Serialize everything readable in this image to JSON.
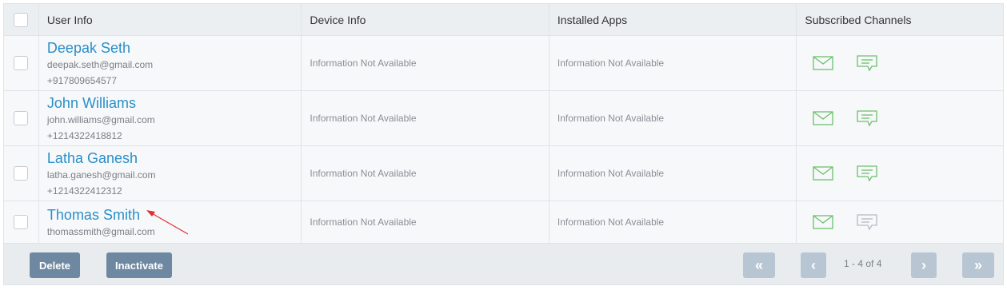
{
  "columns": {
    "user": "User Info",
    "device": "Device Info",
    "apps": "Installed Apps",
    "channels": "Subscribed Channels"
  },
  "rows": [
    {
      "name": "Deepak Seth",
      "email": "deepak.seth@gmail.com",
      "phone": "+917809654577",
      "device": "Information Not Available",
      "apps": "Information Not Available",
      "email_channel": true,
      "sms_channel": true
    },
    {
      "name": "John Williams",
      "email": "john.williams@gmail.com",
      "phone": "+1214322418812",
      "device": "Information Not Available",
      "apps": "Information Not Available",
      "email_channel": true,
      "sms_channel": true
    },
    {
      "name": "Latha Ganesh",
      "email": "latha.ganesh@gmail.com",
      "phone": "+1214322412312",
      "device": "Information Not Available",
      "apps": "Information Not Available",
      "email_channel": true,
      "sms_channel": true
    },
    {
      "name": "Thomas Smith",
      "email": "thomassmith@gmail.com",
      "phone": "",
      "device": "Information Not Available",
      "apps": "Information Not Available",
      "email_channel": true,
      "sms_channel": false
    }
  ],
  "footer": {
    "delete_label": "Delete",
    "inactivate_label": "Inactivate",
    "first_icon": "«",
    "prev_icon": "‹",
    "next_icon": "›",
    "last_icon": "»",
    "page_info": "1 - 4 of 4"
  },
  "colors": {
    "link": "#2a8fc9",
    "channel_active": "#6cc06c",
    "channel_inactive": "#b5bcc3",
    "button": "#6e88a2",
    "pager_disabled": "#b8c6d3",
    "annotation": "#e03030"
  },
  "icons": {
    "email": "mail-icon",
    "sms": "chat-icon"
  }
}
